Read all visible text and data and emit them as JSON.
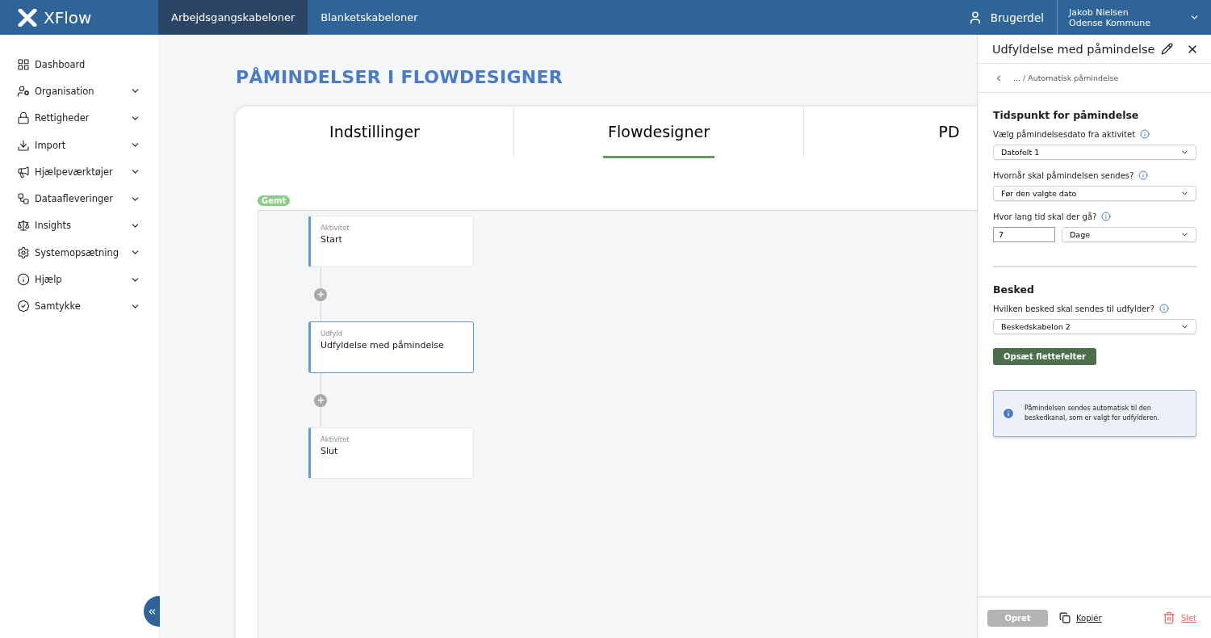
{
  "app": {
    "name": "XFlow"
  },
  "top_tabs": [
    {
      "label": "Arbejdsgangskabeloner",
      "selected": true
    },
    {
      "label": "Blanketskabeloner",
      "selected": false
    }
  ],
  "user_area": {
    "label": "Brugerdel"
  },
  "account": {
    "name": "Jakob Nielsen",
    "organisation": "Odense Kommune"
  },
  "sidebar": {
    "items": [
      {
        "label": "Dashboard",
        "kind": "link"
      },
      {
        "label": "Organisation",
        "kind": "group",
        "expanded": false
      },
      {
        "label": "Rettigheder",
        "kind": "group",
        "expanded": false
      },
      {
        "label": "Import",
        "kind": "group",
        "expanded": false
      },
      {
        "label": "Hjælpeværktøjer",
        "kind": "group",
        "expanded": false
      },
      {
        "label": "Dataafleveringer",
        "kind": "group",
        "expanded": false
      },
      {
        "label": "Insights",
        "kind": "group",
        "expanded": false
      },
      {
        "label": "Systemopsætning",
        "kind": "group",
        "expanded": false
      },
      {
        "label": "Hjælp",
        "kind": "group",
        "expanded": false
      },
      {
        "label": "Samtykke",
        "kind": "group",
        "expanded": false
      }
    ]
  },
  "page": {
    "title": "PÅMINDELSER I FLOWDESIGNER"
  },
  "card_tabs": [
    {
      "label": "Indstillinger",
      "selected": false
    },
    {
      "label": "Flowdesigner",
      "selected": true
    },
    {
      "label": "PD",
      "selected": false
    }
  ],
  "save_status": "Gemt",
  "flow_nodes": [
    {
      "type": "Aktivitet",
      "title": "Start",
      "selected": false
    },
    {
      "type": "Udfyld",
      "title": "Udfyldelse med påmindelse",
      "selected": true
    },
    {
      "type": "Aktivitet",
      "title": "Slut",
      "selected": false
    }
  ],
  "panel": {
    "title": "Udfyldelse med påmindelse",
    "breadcrumb": "... / Automatisk påmindelse",
    "sections": [
      {
        "heading": "Tidspunkt for påmindelse",
        "fields": [
          {
            "kind": "select",
            "label": "Vælg påmindelsesdato fra aktivitet",
            "value": "Datofelt 1"
          },
          {
            "kind": "select",
            "label": "Hvornår skal påmindelsen sendes?",
            "value": "Før den valgte dato"
          },
          {
            "kind": "number-unit",
            "label": "Hvor lang tid skal der gå?",
            "value": "7",
            "unit": "Dage"
          }
        ]
      },
      {
        "heading": "Besked",
        "fields": [
          {
            "kind": "select",
            "label": "Hvilken besked skal sendes til udfylder?",
            "value": "Beskedskabelon 2"
          }
        ]
      }
    ],
    "action_button": "Opsæt flettefelter",
    "info": "Påmindelsen sendes automatisk til den beskedkanal, som er valgt for udfylderen.",
    "footer": {
      "create": {
        "label": "Opret",
        "disabled": true
      },
      "copy": "Kopiér",
      "delete": "Slet"
    }
  }
}
